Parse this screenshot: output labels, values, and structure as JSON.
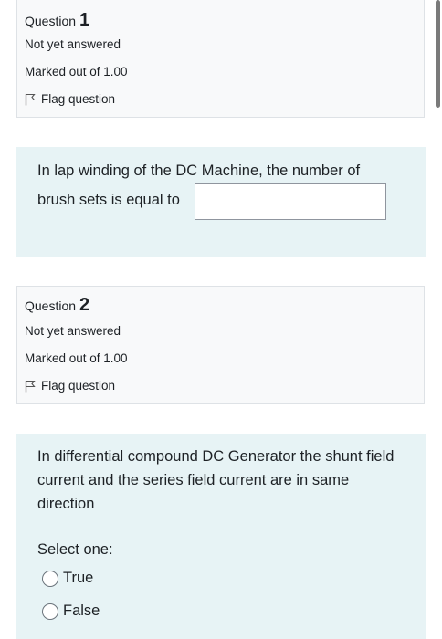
{
  "questions": [
    {
      "label": "Question",
      "number": "1",
      "status": "Not yet answered",
      "marks": "Marked out of 1.00",
      "flag_label": "Flag question",
      "text_line1": "In lap winding of the DC Machine,  the number of",
      "text_line2": "brush sets is equal to",
      "answer_value": ""
    },
    {
      "label": "Question",
      "number": "2",
      "status": "Not yet answered",
      "marks": "Marked out of 1.00",
      "flag_label": "Flag question",
      "text": "In differential  compound DC Generator the shunt field current and the series field current are in same  direction",
      "prompt": "Select one:",
      "options": [
        "True",
        "False"
      ]
    }
  ],
  "icons": {
    "flag": "flag-outline-icon",
    "radio": "radio-unselected-icon"
  }
}
